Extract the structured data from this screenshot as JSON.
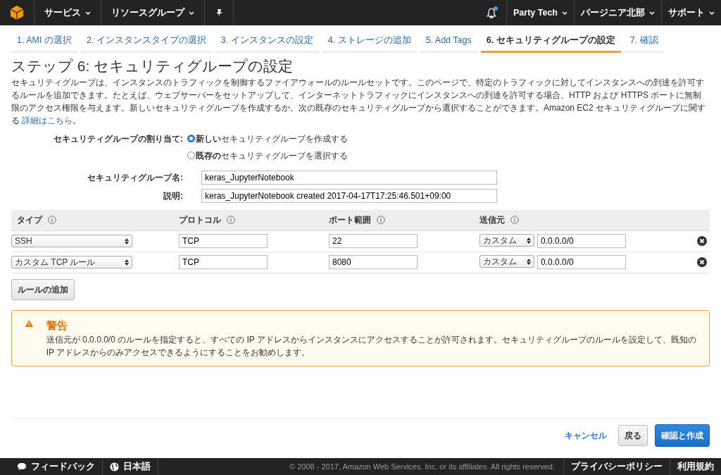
{
  "navbar": {
    "menus": [
      {
        "label": "サービス"
      },
      {
        "label": "リソースグループ"
      }
    ],
    "notification": {
      "unread": true
    },
    "right_menus": [
      {
        "label": "Party Tech"
      },
      {
        "label": "バージニア北部"
      },
      {
        "label": "サポート"
      }
    ]
  },
  "steps": [
    {
      "label": "1. AMI の選択",
      "selected": false
    },
    {
      "label": "2. インスタンスタイプの選択",
      "selected": false
    },
    {
      "label": "3. インスタンスの設定",
      "selected": false
    },
    {
      "label": "4. ストレージの追加",
      "selected": false
    },
    {
      "label": "5. Add Tags",
      "selected": false
    },
    {
      "label": "6. セキュリティグループの設定",
      "selected": true
    },
    {
      "label": "7. 確認",
      "selected": false
    }
  ],
  "title": "ステップ 6: セキュリティグループの設定",
  "description": {
    "text": "セキュリティグループは、インスタンスのトラフィックを制御するファイアウォールのルールセットです。このページで、特定のトラフィックに対してインスタンスへの到達を許可するルールを追加できます。たとえば、ウェブサーバーをセットアップして、インターネットトラフィックにインスタンスへの到達を許可する場合、HTTP および HTTPS ポートに無制限のアクセス権限を与えます。新しいセキュリティグループを作成するか、次の既存のセキュリティグループから選択することができます。Amazon EC2 セキュリティグループに関する ",
    "link": "詳細はこちら",
    "after": "。"
  },
  "assign": {
    "label": "セキュリティグループの割り当て:",
    "options": [
      {
        "label": "**新しい**セキュリティグループを作成する",
        "selected": true
      },
      {
        "label": "**既存の**セキュリティグループを選択する",
        "selected": false
      }
    ]
  },
  "fields": [
    {
      "label": "セキュリティグループ名:",
      "value": "keras_JupyterNotebook"
    },
    {
      "label": "説明:",
      "value": "keras_JupyterNotebook created 2017-04-17T17:25:46.501+09:00"
    }
  ],
  "table": {
    "columns": [
      "タイプ",
      "プロトコル",
      "ポート範囲",
      "送信元"
    ],
    "rows": [
      {
        "type": "SSH",
        "protocol": "TCP",
        "port": "22",
        "source": "カスタム",
        "cidr": "0.0.0.0/0"
      },
      {
        "type": "カスタム TCP ルール",
        "protocol": "TCP",
        "port": "8080",
        "source": "カスタム",
        "cidr": "0.0.0.0/0"
      }
    ]
  },
  "add_rule_button": "ルールの追加",
  "warning": {
    "title": "警告",
    "text": "送信元が 0.0.0.0/0 のルールを指定すると、すべての IP アドレスからインスタンスにアクセスすることが許可されます。セキュリティグループのルールを設定して、既知の IP アドレスからのみアクセスできるようにすることをお勧めします。"
  },
  "actions": {
    "cancel": "キャンセル",
    "back": "戻る",
    "submit": "確認と作成"
  },
  "footer": {
    "feedback": "フィードバック",
    "language": "日本語",
    "copyright": "© 2008 - 2017, Amazon Web Services, Inc. or its affiliates. All rights reserved.",
    "links": [
      "プライバシーポリシー",
      "利用規約"
    ]
  }
}
